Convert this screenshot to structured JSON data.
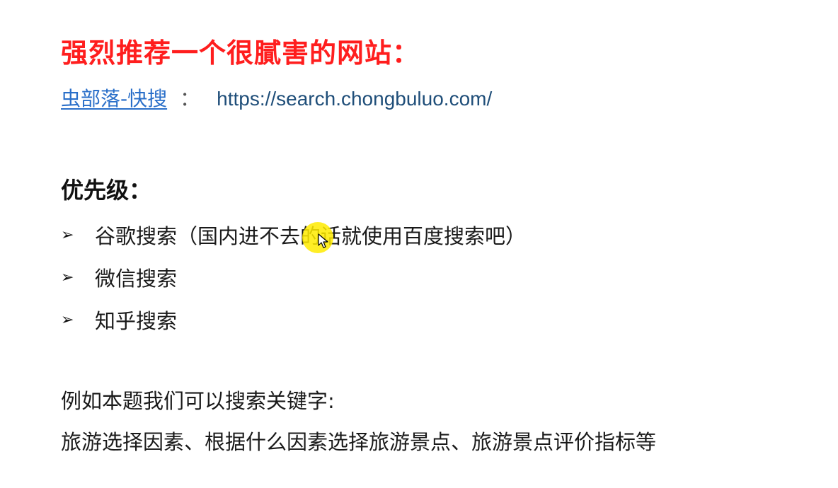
{
  "title": "强烈推荐一个很膩害的网站：",
  "link": {
    "site_name": "虫部落-快搜",
    "separator": "：",
    "url": "https://search.chongbuluo.com/"
  },
  "priority_heading": "优先级：",
  "bullets": [
    {
      "marker": "➢",
      "text": "谷歌搜索（国内进不去的话就使用百度搜索吧）"
    },
    {
      "marker": "➢",
      "text": "微信搜索"
    },
    {
      "marker": "➢",
      "text": "知乎搜索"
    }
  ],
  "example": {
    "intro": "例如本题我们可以搜索关键字:",
    "keywords": "旅游选择因素、根据什么因素选择旅游景点、旅游景点评价指标等"
  },
  "colors": {
    "title": "#ff1e1e",
    "link": "#2a6fc9",
    "url": "#1f4e79",
    "cursor_highlight": "#ffeb00"
  },
  "icons": {
    "cursor": "mouse-pointer-icon",
    "bullet": "arrow-bullet-icon"
  }
}
